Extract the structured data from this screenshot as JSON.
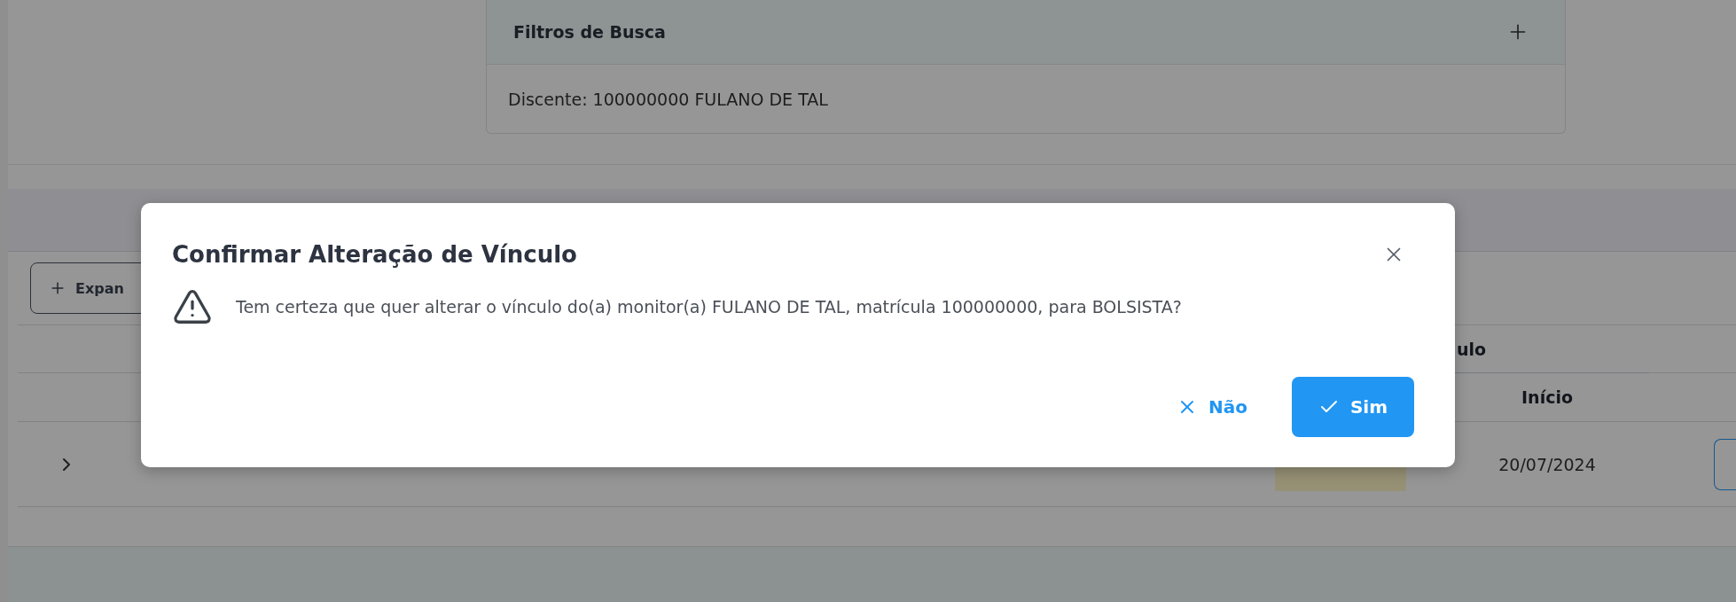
{
  "filters": {
    "title": "Filtros de Busca",
    "summary": "Discente: 100000000 FULANO DE TAL"
  },
  "toolbar": {
    "expand_button": "Expan"
  },
  "table": {
    "group_header": "ulo",
    "columns": [
      "Início"
    ],
    "rows": [
      {
        "expanded": false,
        "date": "20/07/2024"
      }
    ]
  },
  "dialog": {
    "title": "Confirmar Alteração de Vínculo",
    "message": "Tem certeza que quer alterar o vínculo do(a) monitor(a) FULANO DE TAL, matrícula 100000000, para BOLSISTA?",
    "buttons": [
      {
        "label": "Não",
        "kind": "secondary"
      },
      {
        "label": "Sim",
        "kind": "primary"
      }
    ]
  }
}
